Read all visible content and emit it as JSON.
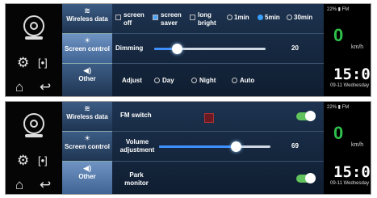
{
  "colors": {
    "accent": "#3aa0ff",
    "speed": "#2ec04a",
    "toggle_on": "#61c35d",
    "tab_active": "#5a80b4"
  },
  "sidebar": {
    "camera_icon": "camera-icon",
    "gear_icon": "gear-icon",
    "cast_icon": "screen-cast-icon",
    "home_icon": "home-icon",
    "back_icon": "back-arrow-icon"
  },
  "tabs": {
    "wireless": "Wireless data",
    "screen_control": "Screen control",
    "other": "Other"
  },
  "status": {
    "battery_fm": "22% ▮ FM",
    "speed": "0",
    "speed_unit": "km/h",
    "time": "15:03",
    "date": "09-11 Wednesday"
  },
  "screen1": {
    "options": {
      "screen_off": "screen off",
      "screen_saver": "screen saver",
      "long_bright": "long bright",
      "t1": "1min",
      "t5": "5min",
      "t30": "30min"
    },
    "dimming": {
      "label": "Dimming",
      "value": "20",
      "level": 0.2
    },
    "adjust": {
      "label": "Adjust",
      "day": "Day",
      "night": "Night",
      "auto": "Auto"
    }
  },
  "screen2": {
    "fm_switch": "FM switch",
    "volume": {
      "label": "Volume adjustment",
      "value": "69",
      "level": 0.69
    },
    "park_monitor": "Park monitor"
  }
}
